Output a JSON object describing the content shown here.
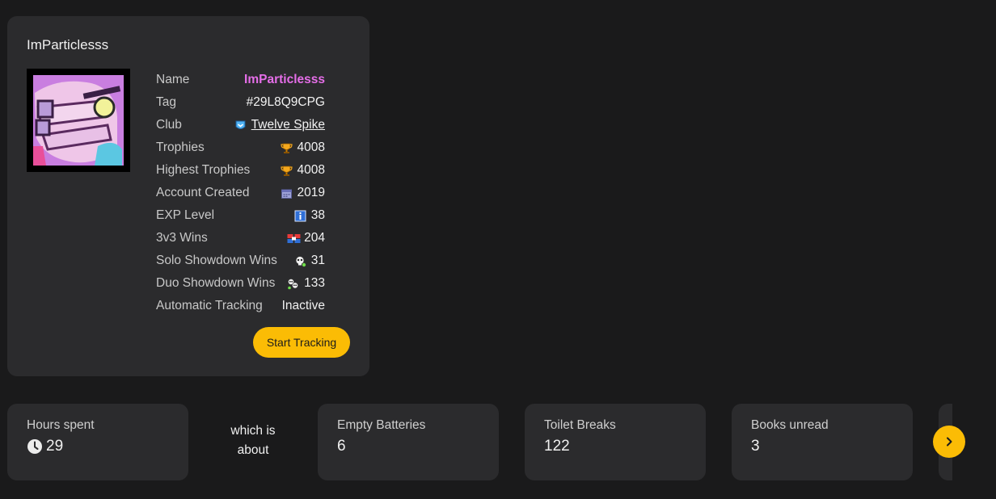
{
  "profile": {
    "title": "ImParticlesss",
    "avatar_icon": "brawler-portrait-icon",
    "rows": [
      {
        "label": "Name",
        "value": "ImParticlesss",
        "icon": null
      },
      {
        "label": "Tag",
        "value": "#29L8Q9CPG",
        "icon": null
      },
      {
        "label": "Club",
        "value": "Twelve Spike",
        "icon": "club-badge-icon"
      },
      {
        "label": "Trophies",
        "value": "4008",
        "icon": "trophy-icon"
      },
      {
        "label": "Highest Trophies",
        "value": "4008",
        "icon": "trophy-icon"
      },
      {
        "label": "Account Created",
        "value": "2019",
        "icon": "calendar-icon"
      },
      {
        "label": "EXP Level",
        "value": "38",
        "icon": "info-icon"
      },
      {
        "label": "3v3 Wins",
        "value": "204",
        "icon": "3v3-icon"
      },
      {
        "label": "Solo Showdown Wins",
        "value": "31",
        "icon": "skull-icon"
      },
      {
        "label": "Duo Showdown Wins",
        "value": "133",
        "icon": "duo-skull-icon"
      },
      {
        "label": "Automatic Tracking",
        "value": "Inactive",
        "icon": null
      }
    ],
    "track_button": "Start Tracking"
  },
  "tiles": [
    {
      "label": "Hours spent",
      "value": "29",
      "icon": "clock-icon"
    },
    {
      "label": "Empty Batteries",
      "value": "6"
    },
    {
      "label": "Toilet Breaks",
      "value": "122"
    },
    {
      "label": "Books unread",
      "value": "3"
    }
  ],
  "connector": {
    "line1": "which is",
    "line2": "about"
  },
  "colors": {
    "background": "#1a1a1b",
    "card": "#2b2b2d",
    "accent": "#fbbc05",
    "name": "#e56ee8"
  }
}
